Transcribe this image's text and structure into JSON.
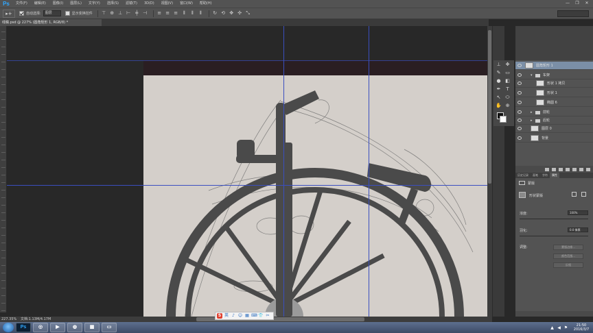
{
  "app": {
    "logo": "Ps",
    "menu": [
      "文件(F)",
      "编辑(E)",
      "图像(I)",
      "图层(L)",
      "文字(Y)",
      "选择(S)",
      "滤镜(T)",
      "3D(D)",
      "视图(V)",
      "窗口(W)",
      "帮助(H)"
    ],
    "window_controls": [
      "—",
      "❐",
      "✕"
    ]
  },
  "options": {
    "tool_icon": "▸+",
    "auto_select_label": "自动选择:",
    "auto_select_value": "图层",
    "show_transform_label": "显示变换控件"
  },
  "document": {
    "tab_title": "线稿.psd @ 227% (圆角矩形 1, RGB/8) *",
    "zoom": "227.35%",
    "doc_size": "文档:1.13M/4.17M"
  },
  "layers": [
    {
      "name": "圆角矩形 1",
      "indent": 0,
      "kind": "shape",
      "selected": true
    },
    {
      "name": "车架",
      "indent": 1,
      "kind": "folder-open",
      "selected": false
    },
    {
      "name": "形状 1 拷贝",
      "indent": 2,
      "kind": "shape",
      "selected": false
    },
    {
      "name": "形状 1",
      "indent": 2,
      "kind": "shape",
      "selected": false
    },
    {
      "name": "椭圆 6",
      "indent": 2,
      "kind": "shape",
      "selected": false
    },
    {
      "name": "前轮",
      "indent": 1,
      "kind": "folder",
      "selected": false
    },
    {
      "name": "后轮",
      "indent": 1,
      "kind": "folder",
      "selected": false
    },
    {
      "name": "图层 0",
      "indent": 1,
      "kind": "image",
      "selected": false
    },
    {
      "name": "背景",
      "indent": 1,
      "kind": "image",
      "selected": false
    }
  ],
  "properties": {
    "tabs": [
      "历史记录",
      "画笔",
      "字符",
      "属性"
    ],
    "active_tab": "属性",
    "section": "蒙版",
    "mask_label": "形状蒙版",
    "density_label": "浓度:",
    "density_value": "100%",
    "feather_label": "羽化:",
    "feather_value": "0.0 像素",
    "refine_label": "调整:",
    "buttons": [
      "蒙版边缘...",
      "颜色范围...",
      "反相"
    ]
  },
  "ime": {
    "icons": [
      "S",
      "英",
      "♪",
      "☺",
      "▦",
      "⌨",
      "👕",
      "✂"
    ]
  },
  "clock": {
    "time": "21:50",
    "date": "2016/3/7"
  }
}
